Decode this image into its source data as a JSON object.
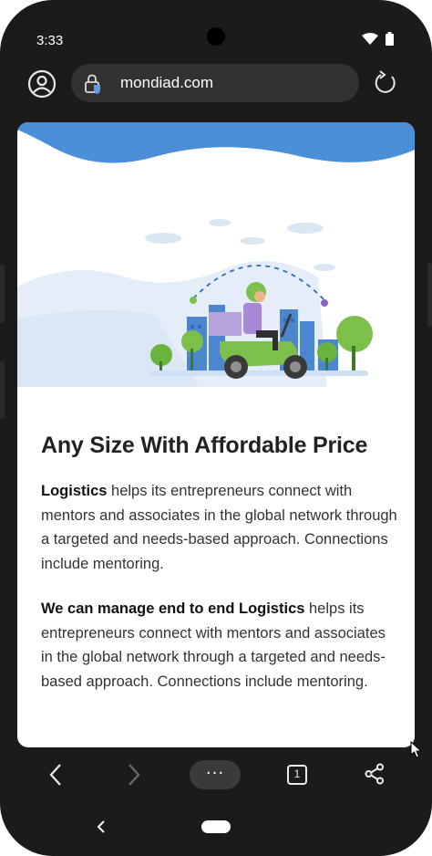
{
  "status_bar": {
    "time": "3:33"
  },
  "browser": {
    "url": "mondiad.com",
    "tab_count": "1",
    "menu_label": "···"
  },
  "page": {
    "heading": "Any Size With Affordable Price",
    "para1_bold": "Logistics",
    "para1_rest": " helps its entrepreneurs connect with mentors and associates in the global network through a targeted and needs-based approach. Connections include mentoring.",
    "para2_bold": "We can manage end to end Logistics",
    "para2_rest": " helps its entrepreneurs connect with mentors and associates in the global network through a targeted and needs-based approach. Connections include mentoring."
  },
  "colors": {
    "accent_blue": "#4b8fd8",
    "scooter_green": "#7cc04b",
    "frame": "#1b1b1b"
  }
}
